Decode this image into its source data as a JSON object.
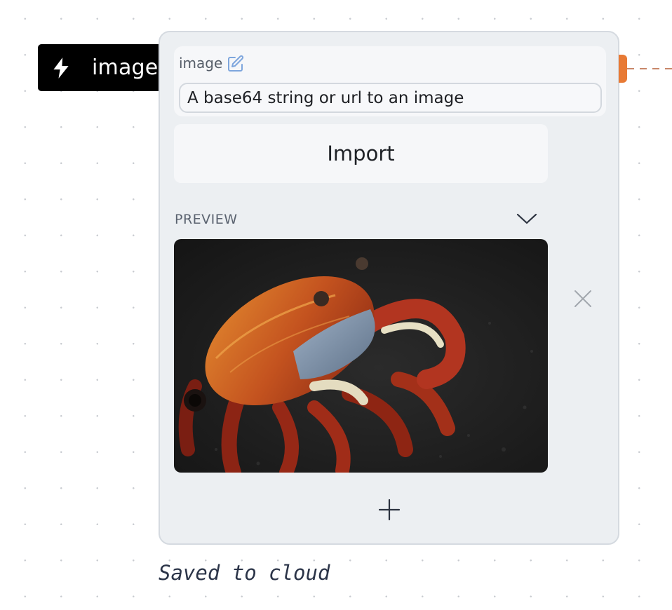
{
  "node": {
    "tag_label": "image",
    "tag_icon": "lightning-bolt-icon"
  },
  "field": {
    "label": "image",
    "edit_icon": "pencil-edit-icon",
    "placeholder": "A base64 string or url to an image",
    "value": ""
  },
  "import_button": {
    "label": "Import"
  },
  "preview": {
    "label": "PREVIEW",
    "toggle_icon": "chevron-down-icon",
    "image_alt": "Red crab on dark rock",
    "remove_icon": "close-icon"
  },
  "add_icon": "plus-icon",
  "status": {
    "text": "Saved to cloud"
  },
  "colors": {
    "accent": "#e87a35",
    "card_bg": "#eceff2",
    "tag_bg": "#000000",
    "edit_icon": "#7ea6dd"
  }
}
